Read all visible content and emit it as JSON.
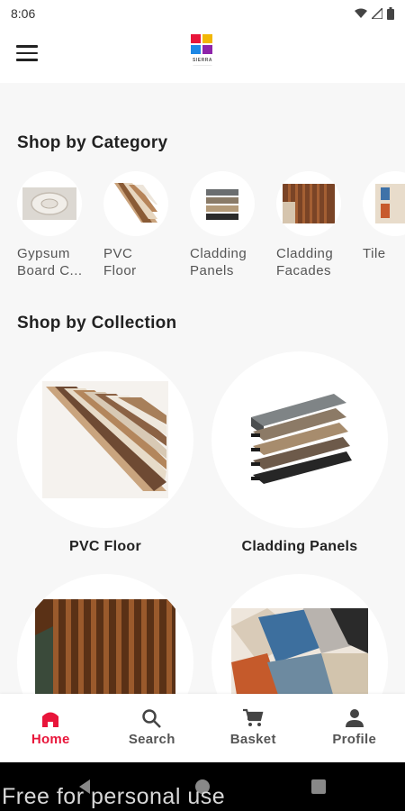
{
  "status": {
    "time": "8:06"
  },
  "appbar": {
    "menu_icon": "hamburger-menu-icon",
    "logo_text": "SIERRA"
  },
  "sections": {
    "category_title": "Shop by Category",
    "collection_title": "Shop by Collection"
  },
  "categories": [
    {
      "label": "Gypsum Board C...",
      "line1": "Gypsum",
      "line2": "Board C..."
    },
    {
      "label": "PVC Floor",
      "line1": "PVC",
      "line2": "Floor"
    },
    {
      "label": "Cladding Panels",
      "line1": "Cladding",
      "line2": "Panels"
    },
    {
      "label": "Cladding Facades",
      "line1": "Cladding",
      "line2": "Facades"
    },
    {
      "label": "Tile",
      "line1": "Tile",
      "line2": ""
    }
  ],
  "collections": [
    {
      "label": "PVC Floor"
    },
    {
      "label": "Cladding Panels"
    },
    {
      "label": ""
    },
    {
      "label": ""
    }
  ],
  "nav": {
    "home": "Home",
    "search": "Search",
    "basket": "Basket",
    "profile": "Profile",
    "active_color": "#e8153a"
  },
  "watermark": "Free for personal use"
}
